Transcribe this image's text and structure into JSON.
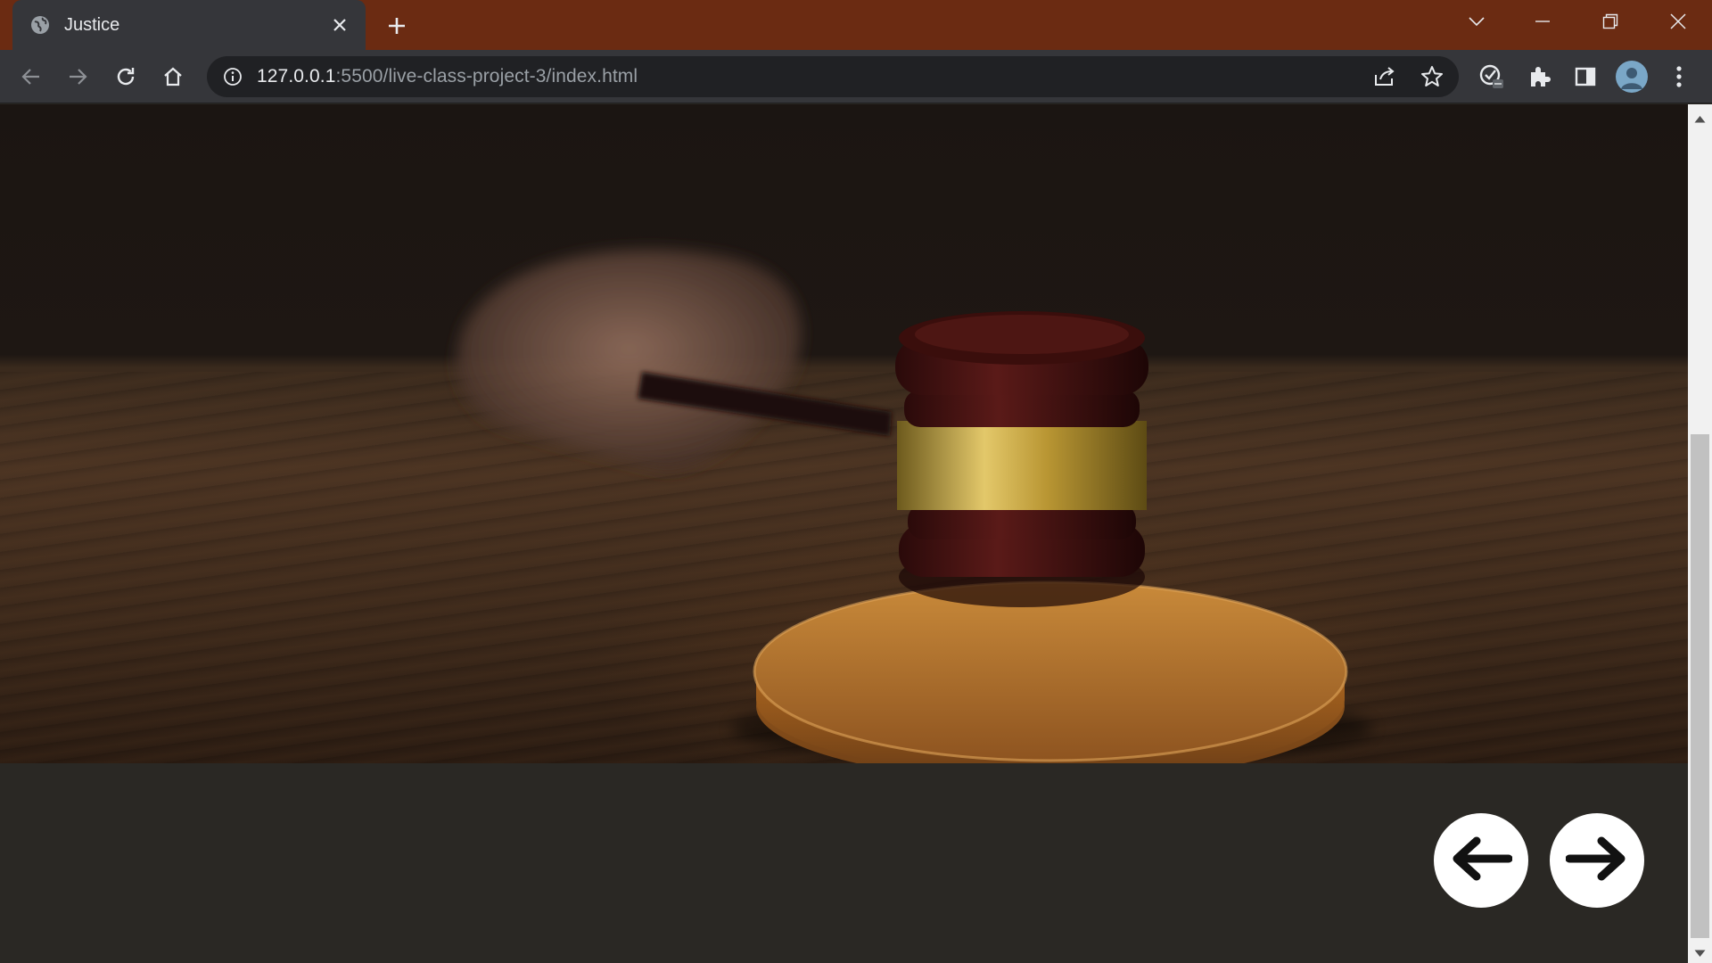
{
  "browser": {
    "tab": {
      "title": "Justice",
      "favicon": "globe-icon"
    },
    "address_bar": {
      "url_host": "127.0.0.1",
      "url_rest": ":5500/live-class-project-3/index.html"
    },
    "colors": {
      "frame": "#6b2b12",
      "toolbar": "#35363a",
      "omnibox": "#202124"
    }
  },
  "page": {
    "hero_image": {
      "subject": "judge gavel on wooden sound block"
    },
    "background_color": "#2a2824",
    "controls": {
      "prev": {
        "icon": "arrow-left-icon"
      },
      "next": {
        "icon": "arrow-right-icon"
      }
    }
  }
}
